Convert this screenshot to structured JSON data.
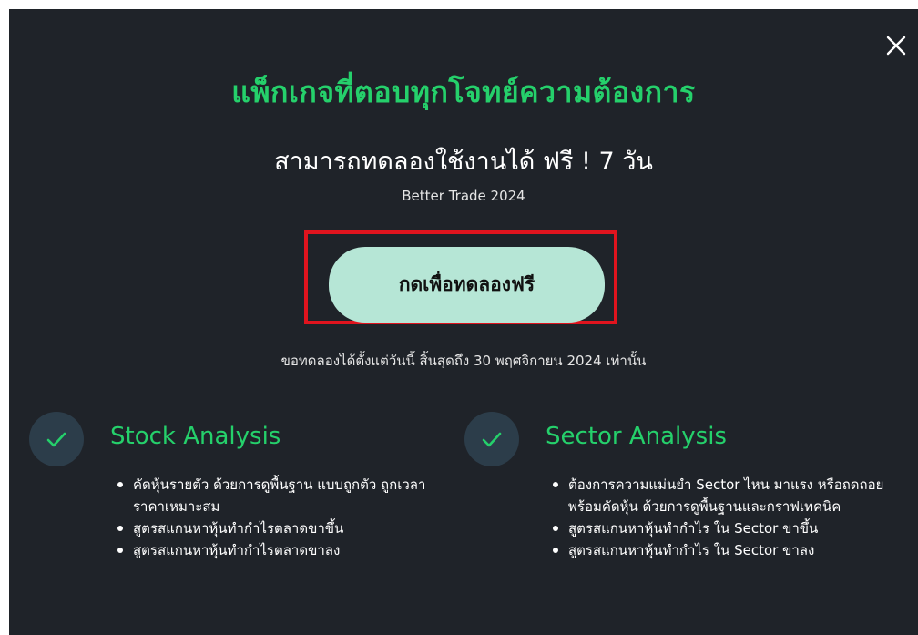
{
  "modal": {
    "title": "แพ็กเกจที่ตอบทุกโจทย์ความต้องการ",
    "subtitle": "สามารถทดลองใช้งานได้ ฟรี ! 7 วัน",
    "brand": "Better Trade 2024",
    "cta_label": "กดเพื่อทดลองฟรี",
    "trial_note": "ขอทดลองได้ตั้งแต่วันนี้ สิ้นสุดถึง 30 พฤศจิกายน 2024 เท่านั้น",
    "close_icon": "close-icon"
  },
  "features": [
    {
      "title": "Stock Analysis",
      "icon": "check-icon",
      "items": [
        "คัดหุ้นรายตัว ด้วยการดูพื้นฐาน แบบถูกตัว ถูกเวลา ราคาเหมาะสม",
        "สูตรสแกนหาหุ้นทำกำไรตลาดขาขึ้น",
        "สูตรสแกนหาหุ้นทำกำไรตลาดขาลง"
      ]
    },
    {
      "title": "Sector Analysis",
      "icon": "check-icon",
      "items": [
        "ต้องการความแม่นยำ Sector ไหน มาแรง หรือถดถอย พร้อมคัดหุ้น ด้วยการดูพื้นฐานและกราฟเทคนิค",
        "สูตรสแกนหาหุ้นทำกำไร ใน Sector ขาขึ้น",
        "สูตรสแกนหาหุ้นทำกำไร ใน Sector ขาลง"
      ]
    }
  ],
  "colors": {
    "background": "#1f2329",
    "accent_green": "#25d06b",
    "cta_bg": "#b6e6d6",
    "highlight_red": "#e0141e",
    "check_circle": "#2c3d4a"
  }
}
